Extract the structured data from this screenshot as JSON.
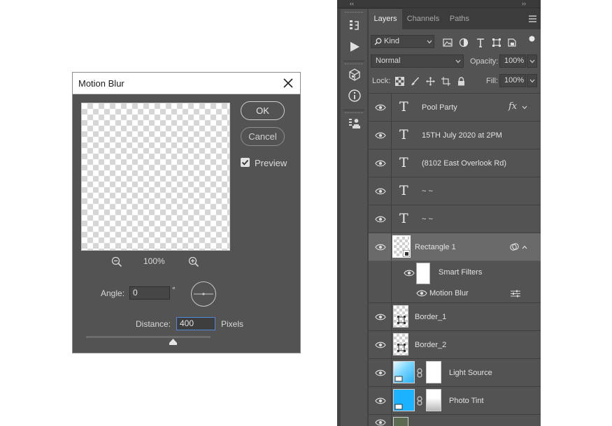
{
  "dialog": {
    "title": "Motion Blur",
    "ok_label": "OK",
    "cancel_label": "Cancel",
    "preview_label": "Preview",
    "preview_checked": true,
    "zoom_level": "100%",
    "angle_label": "Angle:",
    "angle_value": "0",
    "angle_unit": "°",
    "distance_label": "Distance:",
    "distance_value": "400",
    "distance_unit": "Pixels"
  },
  "dock": {
    "collapse_glyph": "‹‹",
    "expand_glyph": "››"
  },
  "panel": {
    "tabs": [
      {
        "label": "Layers",
        "active": true
      },
      {
        "label": "Channels",
        "active": false
      },
      {
        "label": "Paths",
        "active": false
      }
    ],
    "filter_kind": "Kind",
    "blend_mode": "Normal",
    "opacity_label": "Opacity:",
    "opacity_value": "100%",
    "lock_label": "Lock:",
    "fill_label": "Fill:",
    "fill_value": "100%"
  },
  "layers": [
    {
      "name": "Pool  Party",
      "kind": "text",
      "fx": "fx"
    },
    {
      "name": "15TH July 2020 at 2PM",
      "kind": "text"
    },
    {
      "name": "(8102 East Overlook Rd)",
      "kind": "text"
    },
    {
      "name": "~ ~",
      "kind": "text"
    },
    {
      "name": "~ ~",
      "kind": "text"
    },
    {
      "name": "Rectangle 1",
      "kind": "smart-object",
      "selected": true
    },
    {
      "name": "Smart Filters",
      "kind": "smart-filters"
    },
    {
      "name": "Motion Blur",
      "kind": "filter"
    },
    {
      "name": "Border_1",
      "kind": "shape"
    },
    {
      "name": "Border_2",
      "kind": "shape"
    },
    {
      "name": "Light Source",
      "kind": "masked-image"
    },
    {
      "name": "Photo Tint",
      "kind": "masked-fill"
    }
  ],
  "colors": {
    "panel_bg": "#535353",
    "selected_row": "#6a6a6a",
    "focus_border": "#4d8bd6",
    "photo_tint": "#1bb3ff"
  }
}
